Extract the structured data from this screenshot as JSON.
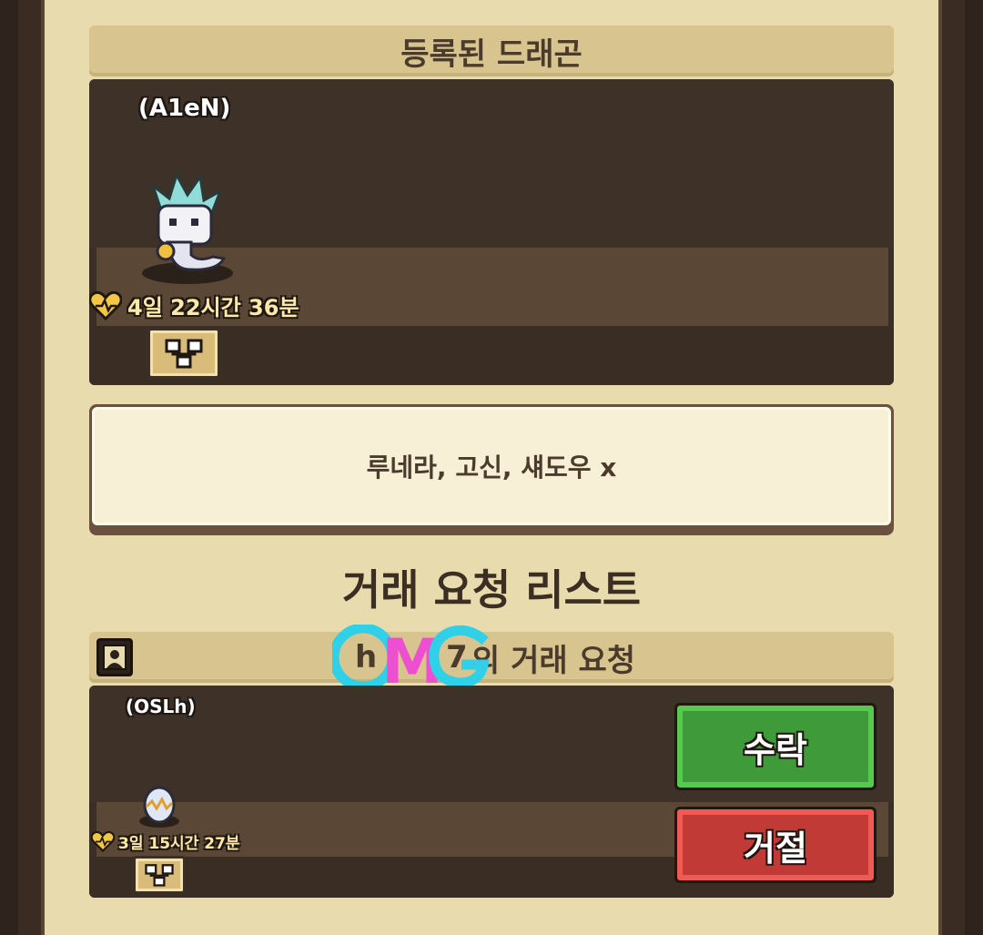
{
  "registered_panel": {
    "title": "등록된 드래곤",
    "dragon_owner": "(A1eN)",
    "timer": "4일 22시간 36분"
  },
  "wish_note": "루네라, 고신, 섀도우 x",
  "trade_list": {
    "title": "거래 요청 리스트",
    "request_header_suffix": "의 거래 요청",
    "request_header_prefix_visible": "h",
    "request_header_mid_visible": "7",
    "request": {
      "owner": "(OSLh)",
      "timer": "3일 15시간 27분",
      "accept_label": "수락",
      "reject_label": "거절"
    }
  },
  "watermark_text": "OMG",
  "icons": [
    "heart-icon",
    "family-tree-icon",
    "profile-icon",
    "dragon-sprite",
    "egg-sprite"
  ],
  "colors": {
    "panel_bg": "#e8dcae",
    "header_bg": "#d7c48f",
    "dark_panel": "#3a2f26",
    "accept_green": "#3f9a3a",
    "reject_red": "#c23a36",
    "timer_yellow": "#ffe9a8"
  }
}
